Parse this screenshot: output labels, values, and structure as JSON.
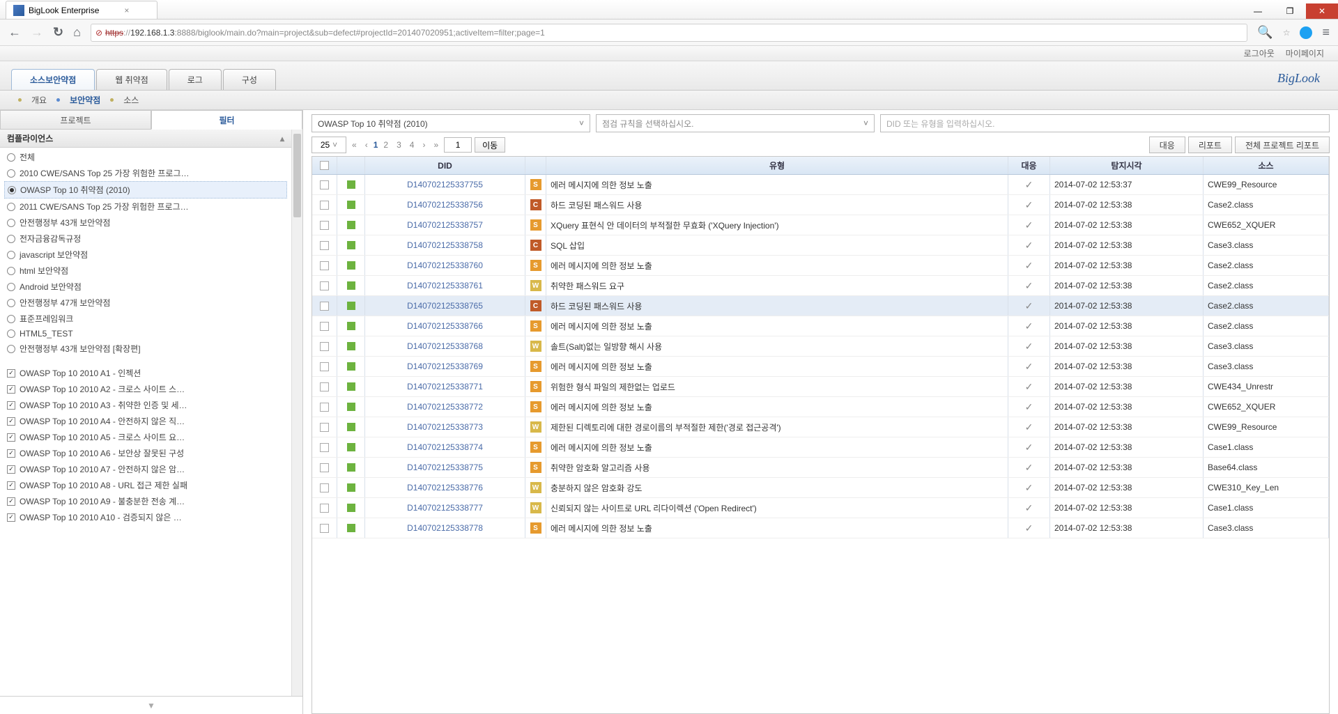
{
  "browser": {
    "tab_title": "BigLook Enterprise",
    "url_protocol_struck": "https",
    "url_sep": "://",
    "url_host": "192.168.1.3",
    "url_path": ":8888/biglook/main.do?main=project&sub=defect#projectId=201407020951;activeItem=filter;page=1"
  },
  "top_links": {
    "logout": "로그아웃",
    "mypage": "마이페이지"
  },
  "brand": "BigLook",
  "main_tabs": {
    "t1": "소스보안약점",
    "t2": "웹 취약점",
    "t3": "로그",
    "t4": "구성"
  },
  "breadcrumb": {
    "b1": "개요",
    "b2": "보안약점",
    "b3": "소스"
  },
  "side_tabs": {
    "project": "프로젝트",
    "filter": "필터"
  },
  "compliance_header": "컴플라이언스",
  "radio_items": [
    "전체",
    "2010 CWE/SANS Top 25 가장 위험한 프로그…",
    "OWASP Top 10 취약점 (2010)",
    "2011 CWE/SANS Top 25 가장 위험한 프로그…",
    "안전행정부 43개 보안약점",
    "전자금융감독규정",
    "javascript 보안약점",
    "html 보안약점",
    "Android 보안약점",
    "안전행정부 47개 보안약점",
    "표준프레임워크",
    "HTML5_TEST",
    "안전행정부 43개 보안약점 [확장편]"
  ],
  "radio_selected": 2,
  "check_items": [
    "OWASP Top 10 2010 A1 - 인젝션",
    "OWASP Top 10 2010 A2 - 크로스 사이트 스…",
    "OWASP Top 10 2010 A3 - 취약한 인증 및 세…",
    "OWASP Top 10 2010 A4 - 안전하지 않은 직…",
    "OWASP Top 10 2010 A5 - 크로스 사이트 요…",
    "OWASP Top 10 2010 A6 - 보안상 잘못된 구성",
    "OWASP Top 10 2010 A7 - 안전하지 않은 암…",
    "OWASP Top 10 2010 A8 - URL 접근 제한 실패",
    "OWASP Top 10 2010 A9 - 불충분한 전송 계…",
    "OWASP Top 10 2010 A10 - 검증되지 않은 …"
  ],
  "filters": {
    "compliance_select": "OWASP Top 10 취약점 (2010)",
    "rule_placeholder": "점검 규칙을 선택하십시오.",
    "search_placeholder": "DID 또는 유형을 입력하십시오."
  },
  "pager": {
    "page_size": "25",
    "p1": "1",
    "p2": "2",
    "p3": "3",
    "p4": "4",
    "page_input": "1",
    "go": "이동"
  },
  "actions": {
    "respond": "대응",
    "report": "리포트",
    "all_report": "전체 프로젝트 리포트"
  },
  "columns": {
    "did": "DID",
    "type": "유형",
    "resp": "대응",
    "time": "탐지시각",
    "src": "소스"
  },
  "rows": [
    {
      "did": "D140702125337755",
      "cat": "S",
      "type": "에러 메시지에 의한 정보 노출",
      "resp": true,
      "time": "2014-07-02 12:53:37",
      "src": "CWE99_Resource"
    },
    {
      "did": "D140702125338756",
      "cat": "C",
      "type": "하드 코딩된 패스워드 사용",
      "resp": true,
      "time": "2014-07-02 12:53:38",
      "src": "Case2.class"
    },
    {
      "did": "D140702125338757",
      "cat": "S",
      "type": "XQuery 표현식 안 데이터의 부적절한 무효화 ('XQuery Injection')",
      "resp": true,
      "time": "2014-07-02 12:53:38",
      "src": "CWE652_XQUER"
    },
    {
      "did": "D140702125338758",
      "cat": "C",
      "type": "SQL 삽입",
      "resp": true,
      "time": "2014-07-02 12:53:38",
      "src": "Case3.class"
    },
    {
      "did": "D140702125338760",
      "cat": "S",
      "type": "에러 메시지에 의한 정보 노출",
      "resp": true,
      "time": "2014-07-02 12:53:38",
      "src": "Case2.class"
    },
    {
      "did": "D140702125338761",
      "cat": "W",
      "type": "취약한 패스워드 요구",
      "resp": true,
      "time": "2014-07-02 12:53:38",
      "src": "Case2.class"
    },
    {
      "did": "D140702125338765",
      "cat": "C",
      "type": "하드 코딩된 패스워드 사용",
      "resp": true,
      "time": "2014-07-02 12:53:38",
      "src": "Case2.class",
      "sel": true
    },
    {
      "did": "D140702125338766",
      "cat": "S",
      "type": "에러 메시지에 의한 정보 노출",
      "resp": true,
      "time": "2014-07-02 12:53:38",
      "src": "Case2.class"
    },
    {
      "did": "D140702125338768",
      "cat": "W",
      "type": "솔트(Salt)없는 일방향 해시 사용",
      "resp": true,
      "time": "2014-07-02 12:53:38",
      "src": "Case3.class"
    },
    {
      "did": "D140702125338769",
      "cat": "S",
      "type": "에러 메시지에 의한 정보 노출",
      "resp": true,
      "time": "2014-07-02 12:53:38",
      "src": "Case3.class"
    },
    {
      "did": "D140702125338771",
      "cat": "S",
      "type": "위험한 형식 파일의 제한없는 업로드",
      "resp": true,
      "time": "2014-07-02 12:53:38",
      "src": "CWE434_Unrestr"
    },
    {
      "did": "D140702125338772",
      "cat": "S",
      "type": "에러 메시지에 의한 정보 노출",
      "resp": true,
      "time": "2014-07-02 12:53:38",
      "src": "CWE652_XQUER"
    },
    {
      "did": "D140702125338773",
      "cat": "W",
      "type": "제한된 디렉토리에 대한 경로이름의 부적절한 제한('경로 접근공격')",
      "resp": true,
      "time": "2014-07-02 12:53:38",
      "src": "CWE99_Resource"
    },
    {
      "did": "D140702125338774",
      "cat": "S",
      "type": "에러 메시지에 의한 정보 노출",
      "resp": true,
      "time": "2014-07-02 12:53:38",
      "src": "Case1.class"
    },
    {
      "did": "D140702125338775",
      "cat": "S",
      "type": "취약한 암호화 알고리즘 사용",
      "resp": true,
      "time": "2014-07-02 12:53:38",
      "src": "Base64.class"
    },
    {
      "did": "D140702125338776",
      "cat": "W",
      "type": "충분하지 않은 암호화 강도",
      "resp": true,
      "time": "2014-07-02 12:53:38",
      "src": "CWE310_Key_Len"
    },
    {
      "did": "D140702125338777",
      "cat": "W",
      "type": "신뢰되지 않는 사이트로 URL 리다이렉션 ('Open Redirect')",
      "resp": true,
      "time": "2014-07-02 12:53:38",
      "src": "Case1.class"
    },
    {
      "did": "D140702125338778",
      "cat": "S",
      "type": "에러 메시지에 의한 정보 노출",
      "resp": true,
      "time": "2014-07-02 12:53:38",
      "src": "Case3.class"
    }
  ]
}
